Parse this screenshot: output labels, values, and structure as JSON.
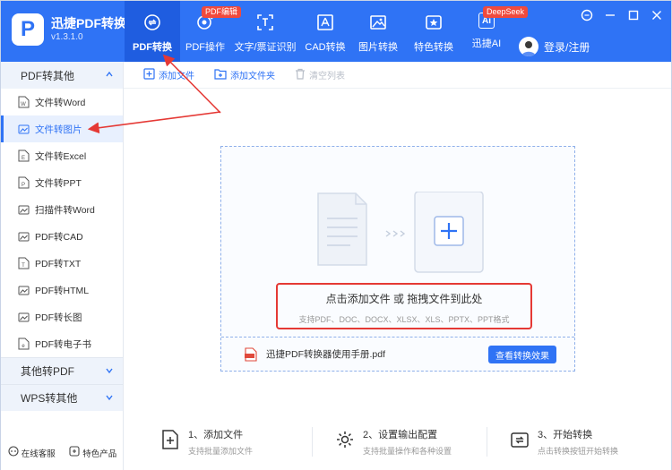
{
  "app": {
    "name": "迅捷PDF转换器",
    "version": "v1.3.1.0",
    "logo_letter": "P"
  },
  "nav": [
    {
      "label": "PDF转换",
      "icon": "convert-icon",
      "active": true
    },
    {
      "label": "PDF操作",
      "icon": "pdf-operation-icon",
      "badge": "PDF编辑"
    },
    {
      "label": "文字/票证识别",
      "icon": "ocr-icon"
    },
    {
      "label": "CAD转换",
      "icon": "cad-icon"
    },
    {
      "label": "图片转换",
      "icon": "image-icon"
    },
    {
      "label": "特色转换",
      "icon": "star-icon"
    },
    {
      "label": "迅捷AI",
      "icon": "ai-icon",
      "badge": "DeepSeek",
      "icon_text": "Ai"
    }
  ],
  "user": {
    "login_label": "登录/注册"
  },
  "sidebar": {
    "group_main": "PDF转其他",
    "items": [
      {
        "label": "文件转Word",
        "icon": "word-icon",
        "glyph": "W"
      },
      {
        "label": "文件转图片",
        "icon": "picture-icon",
        "active": true
      },
      {
        "label": "文件转Excel",
        "icon": "excel-icon",
        "glyph": "E"
      },
      {
        "label": "文件转PPT",
        "icon": "ppt-icon",
        "glyph": "P"
      },
      {
        "label": "扫描件转Word",
        "icon": "scan-icon"
      },
      {
        "label": "PDF转CAD",
        "icon": "cad-file-icon"
      },
      {
        "label": "PDF转TXT",
        "icon": "txt-icon",
        "glyph": "T"
      },
      {
        "label": "PDF转HTML",
        "icon": "html-icon"
      },
      {
        "label": "PDF转长图",
        "icon": "long-image-icon"
      },
      {
        "label": "PDF转电子书",
        "icon": "ebook-icon",
        "glyph": "e"
      }
    ],
    "group_other": "其他转PDF",
    "group_wps": "WPS转其他",
    "footer": {
      "service": "在线客服",
      "products": "特色产品"
    }
  },
  "toolbar": {
    "add_file": "添加文件",
    "add_folder": "添加文件夹",
    "clear_list": "清空列表"
  },
  "dropzone": {
    "title": "点击添加文件 或 拖拽文件到此处",
    "formats": "支持PDF、DOC、DOCX、XLSX、XLS、PPTX、PPT格式",
    "file_name": "迅捷PDF转换器使用手册.pdf",
    "preview_button": "查看转换效果"
  },
  "steps": [
    {
      "title": "1、添加文件",
      "desc": "支持批量添加文件",
      "icon": "add-file-icon"
    },
    {
      "title": "2、设置输出配置",
      "desc": "支持批量操作和各种设置",
      "icon": "settings-gear-icon"
    },
    {
      "title": "3、开始转换",
      "desc": "点击转换按钮开始转换",
      "icon": "start-convert-icon"
    }
  ],
  "colors": {
    "primary": "#2f73f5",
    "badge": "#f04a3d",
    "annotation": "#e53935"
  }
}
